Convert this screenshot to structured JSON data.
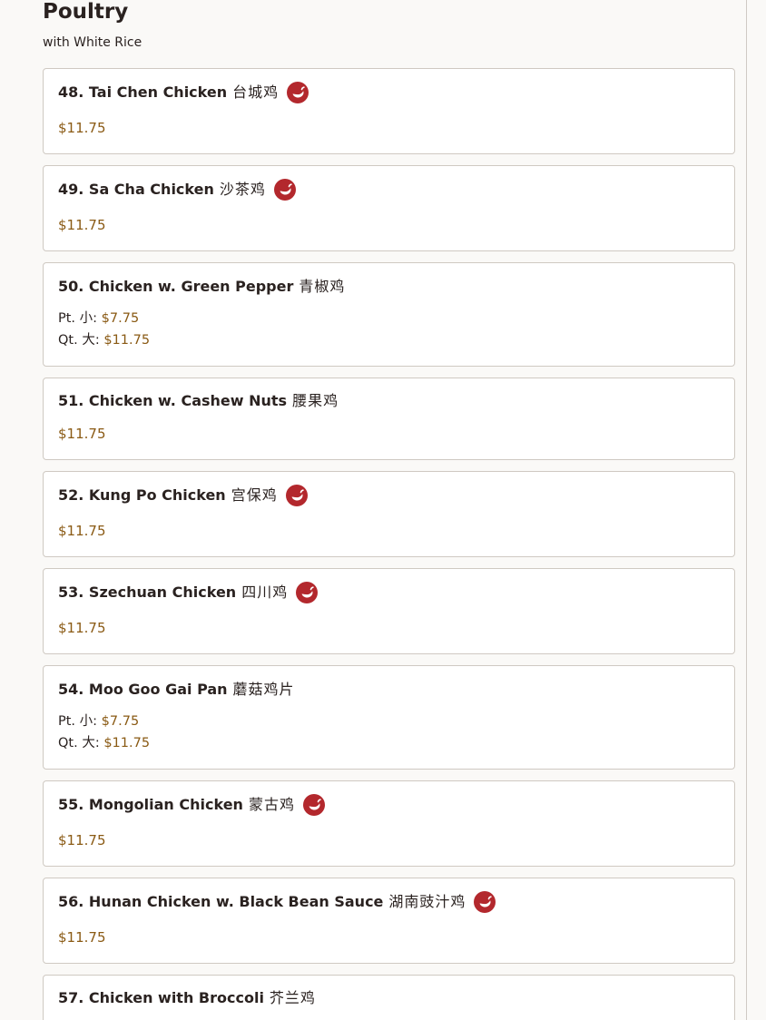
{
  "section": {
    "title": "Poultry",
    "subtitle": "with White Rice"
  },
  "spicy_icon": "chili-pepper-icon",
  "colors": {
    "spicy_badge": "#b3282d",
    "price": "#8a5a14"
  },
  "items": [
    {
      "name": "48. Tai Chen Chicken",
      "chinese": "台城鸡",
      "spicy": true,
      "price": "$11.75"
    },
    {
      "name": "49. Sa Cha Chicken",
      "chinese": "沙茶鸡",
      "spicy": true,
      "price": "$11.75"
    },
    {
      "name": "50. Chicken w. Green Pepper",
      "chinese": "青椒鸡",
      "spicy": false,
      "pt_label": "Pt. 小:",
      "pt_price": "$7.75",
      "qt_label": "Qt. 大:",
      "qt_price": "$11.75"
    },
    {
      "name": "51. Chicken w. Cashew Nuts",
      "chinese": "腰果鸡",
      "spicy": false,
      "price": "$11.75"
    },
    {
      "name": "52. Kung Po Chicken",
      "chinese": "宫保鸡",
      "spicy": true,
      "price": "$11.75"
    },
    {
      "name": "53. Szechuan Chicken",
      "chinese": "四川鸡",
      "spicy": true,
      "price": "$11.75"
    },
    {
      "name": "54. Moo Goo Gai Pan",
      "chinese": "蘑菇鸡片",
      "spicy": false,
      "pt_label": "Pt. 小:",
      "pt_price": "$7.75",
      "qt_label": "Qt. 大:",
      "qt_price": "$11.75"
    },
    {
      "name": "55. Mongolian Chicken",
      "chinese": "蒙古鸡",
      "spicy": true,
      "price": "$11.75"
    },
    {
      "name": "56. Hunan Chicken w. Black Bean Sauce",
      "chinese": "湖南豉汁鸡",
      "spicy": true,
      "price": "$11.75"
    },
    {
      "name": "57. Chicken with Broccoli",
      "chinese": "芥兰鸡",
      "spicy": false
    }
  ]
}
